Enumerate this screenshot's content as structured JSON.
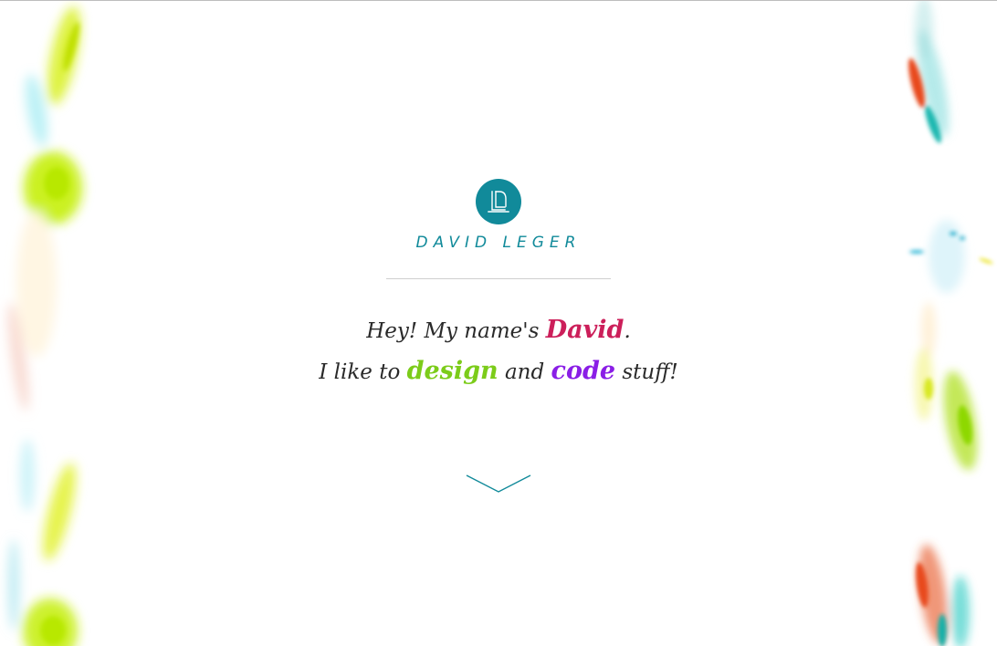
{
  "brand": {
    "name": "DAVID LEGER",
    "accent_color": "#118a9a",
    "logo_icon": "dl-monogram-icon"
  },
  "intro": {
    "line1_prefix": "Hey! My name's ",
    "line1_name": "David",
    "line1_suffix": ".",
    "line2_prefix": "I like to ",
    "line2_word1": "design",
    "line2_mid": " and ",
    "line2_word2": "code",
    "line2_suffix": " stuff!"
  },
  "colors": {
    "name": "#cc1f5a",
    "design": "#7ccc1a",
    "code": "#8a1ee6",
    "text": "#2a2a2a"
  },
  "scroll_icon": "chevron-down-icon"
}
